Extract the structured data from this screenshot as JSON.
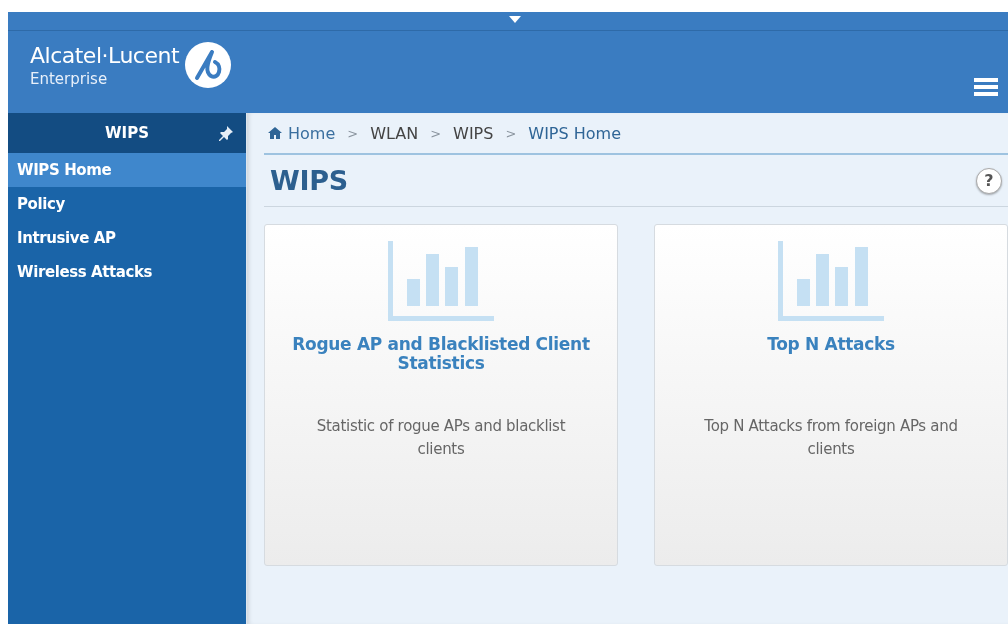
{
  "header": {
    "brand": "Alcatel·Lucent",
    "subtitle": "Enterprise"
  },
  "sidebar": {
    "title": "WIPS",
    "items": [
      {
        "label": "WIPS Home",
        "selected": true
      },
      {
        "label": "Policy",
        "selected": false
      },
      {
        "label": "Intrusive AP",
        "selected": false
      },
      {
        "label": "Wireless Attacks",
        "selected": false
      }
    ]
  },
  "breadcrumb": [
    {
      "kind": "home",
      "text": "Home"
    },
    {
      "kind": "separator",
      "text": ">"
    },
    {
      "kind": "plain",
      "text": "WLAN"
    },
    {
      "kind": "separator",
      "text": ">"
    },
    {
      "kind": "plain",
      "text": "WIPS"
    },
    {
      "kind": "separator",
      "text": ">"
    },
    {
      "kind": "current",
      "text": "WIPS Home"
    }
  ],
  "page": {
    "title": "WIPS",
    "help": "?"
  },
  "cards": [
    {
      "title": "Rogue AP and Blacklisted Client Statistics",
      "description": "Statistic of rogue APs and blacklist clients"
    },
    {
      "title": "Top N Attacks",
      "description": "Top N Attacks from foreign APs and clients"
    }
  ]
}
